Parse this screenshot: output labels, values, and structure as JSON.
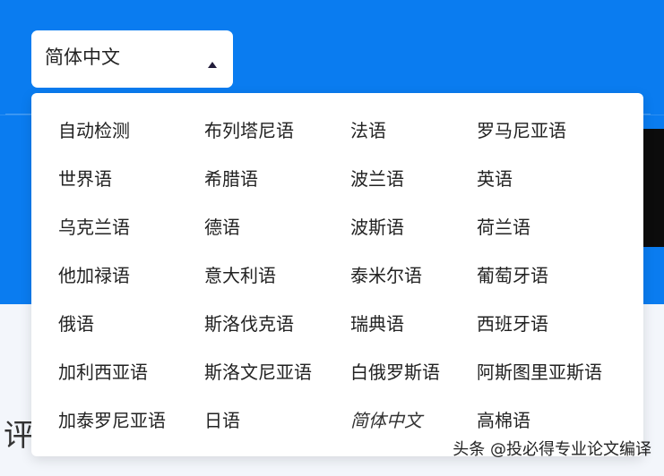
{
  "selector": {
    "selected_value": "简体中文",
    "caret_icon": "caret-up-icon"
  },
  "dropdown": {
    "options": [
      {
        "label": "自动检测"
      },
      {
        "label": "布列塔尼语"
      },
      {
        "label": "法语"
      },
      {
        "label": "罗马尼亚语"
      },
      {
        "label": "世界语"
      },
      {
        "label": "希腊语"
      },
      {
        "label": "波兰语"
      },
      {
        "label": "英语"
      },
      {
        "label": "乌克兰语"
      },
      {
        "label": "德语"
      },
      {
        "label": "波斯语"
      },
      {
        "label": "荷兰语"
      },
      {
        "label": "他加禄语"
      },
      {
        "label": "意大利语"
      },
      {
        "label": "泰米尔语"
      },
      {
        "label": "葡萄牙语"
      },
      {
        "label": "俄语"
      },
      {
        "label": "斯洛伐克语"
      },
      {
        "label": "瑞典语"
      },
      {
        "label": "西班牙语"
      },
      {
        "label": "加利西亚语"
      },
      {
        "label": "斯洛文尼亚语"
      },
      {
        "label": "白俄罗斯语"
      },
      {
        "label": "阿斯图里亚斯语"
      },
      {
        "label": "加泰罗尼亚语"
      },
      {
        "label": "日语"
      },
      {
        "label": "简体中文",
        "selected": true
      },
      {
        "label": "高棉语"
      }
    ]
  },
  "page": {
    "heading_fragment": "评"
  },
  "watermark": {
    "text": "头条 @投必得专业论文编译"
  },
  "colors": {
    "header_blue": "#0a7cf0",
    "page_background": "#f3f6fb",
    "text_dark": "#222222",
    "caret": "#221d3a"
  }
}
